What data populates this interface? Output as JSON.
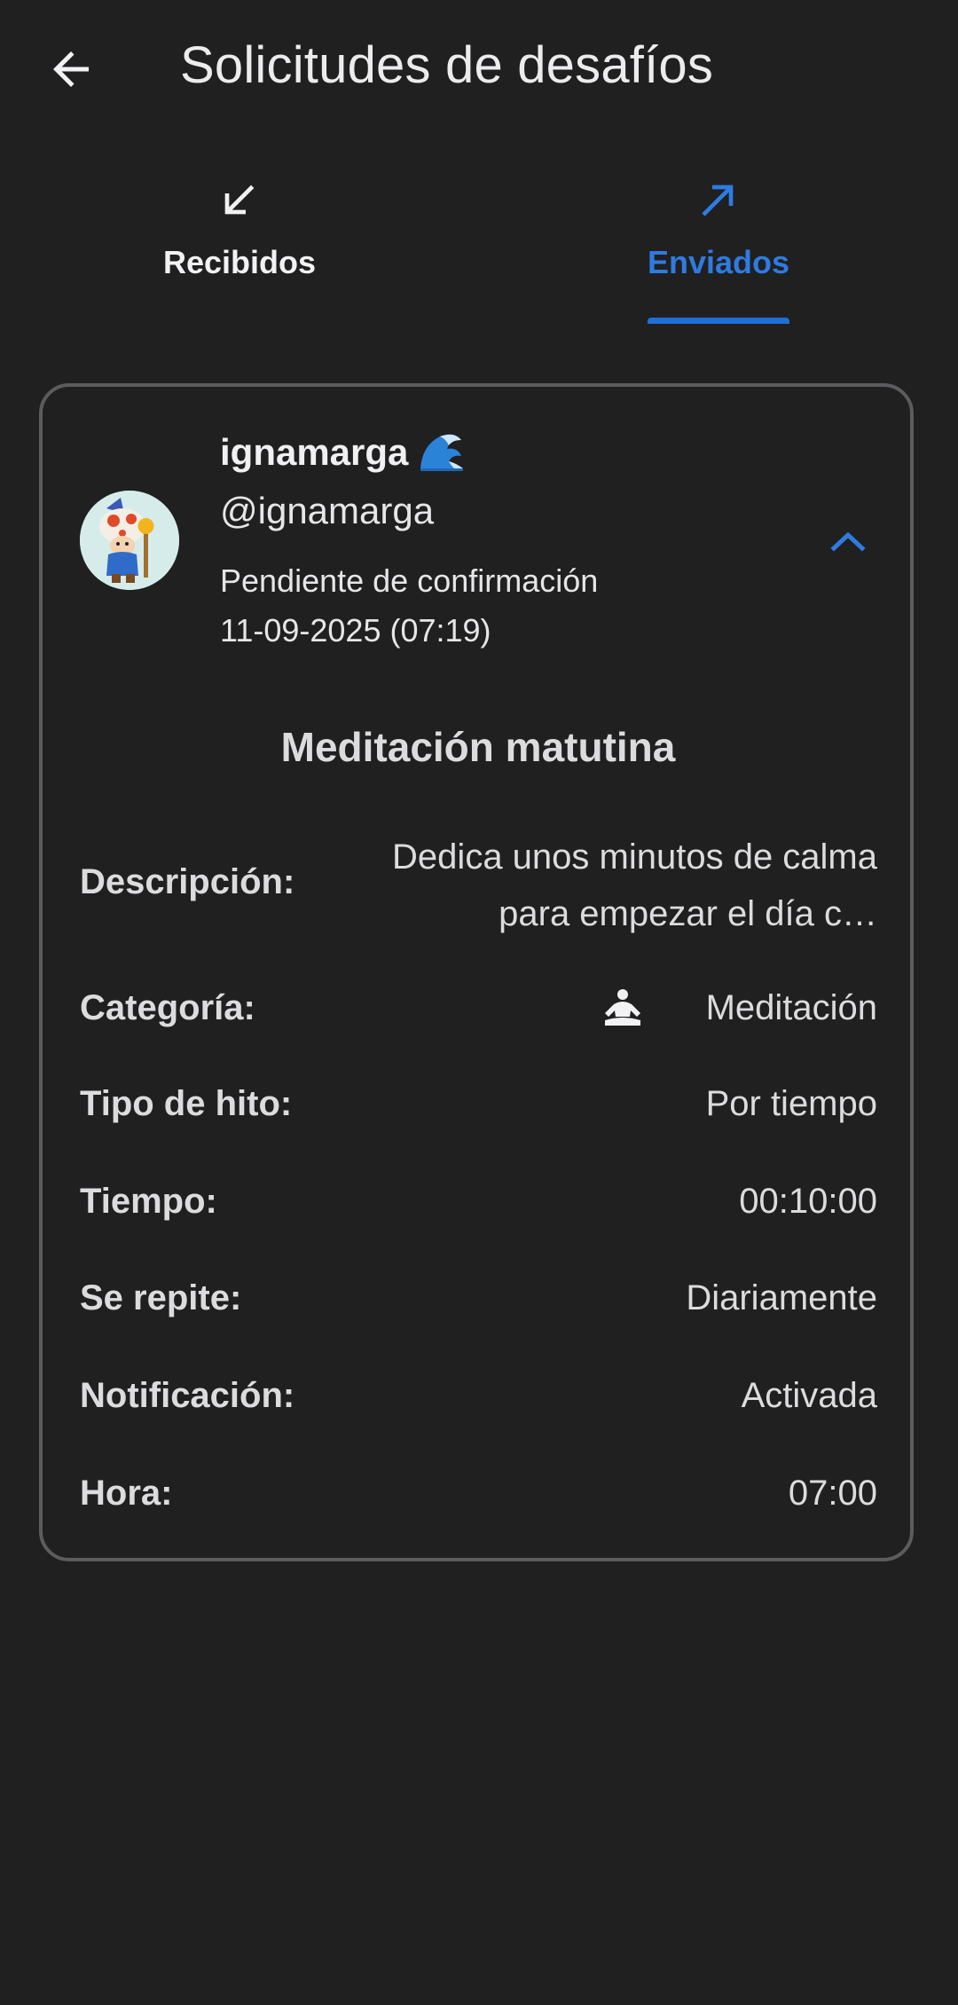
{
  "app_bar": {
    "title": "Solicitudes de desafíos",
    "back_icon": "arrow-back-icon"
  },
  "tabs": [
    {
      "label": "Recibidos",
      "icon": "arrow-down-left-icon",
      "selected": false
    },
    {
      "label": "Enviados",
      "icon": "arrow-up-right-icon",
      "selected": true
    }
  ],
  "request": {
    "display_name": "ignamarga",
    "name_emoji": "wave-emoji-icon",
    "handle": "@ignamarga",
    "status": "Pendiente de confirmación",
    "date": "11-09-2025 (07:19)",
    "expanded": true
  },
  "challenge": {
    "title": "Meditación matutina",
    "rows": [
      {
        "label": "Descripción:",
        "value": "Dedica unos minutos de calma para empezar el día c…"
      },
      {
        "label": "Categoría:",
        "value": "Meditación",
        "icon": "meditation-icon"
      },
      {
        "label": "Tipo de hito:",
        "value": "Por tiempo"
      },
      {
        "label": "Tiempo:",
        "value": "00:10:00"
      },
      {
        "label": "Se repite:",
        "value": "Diariamente"
      },
      {
        "label": "Notificación:",
        "value": "Activada"
      },
      {
        "label": "Hora:",
        "value": "07:00"
      }
    ]
  },
  "colors": {
    "background": "#202021",
    "accent": "#1f6fd6",
    "border": "#5c5c5f",
    "text": "#e8e8ea"
  }
}
